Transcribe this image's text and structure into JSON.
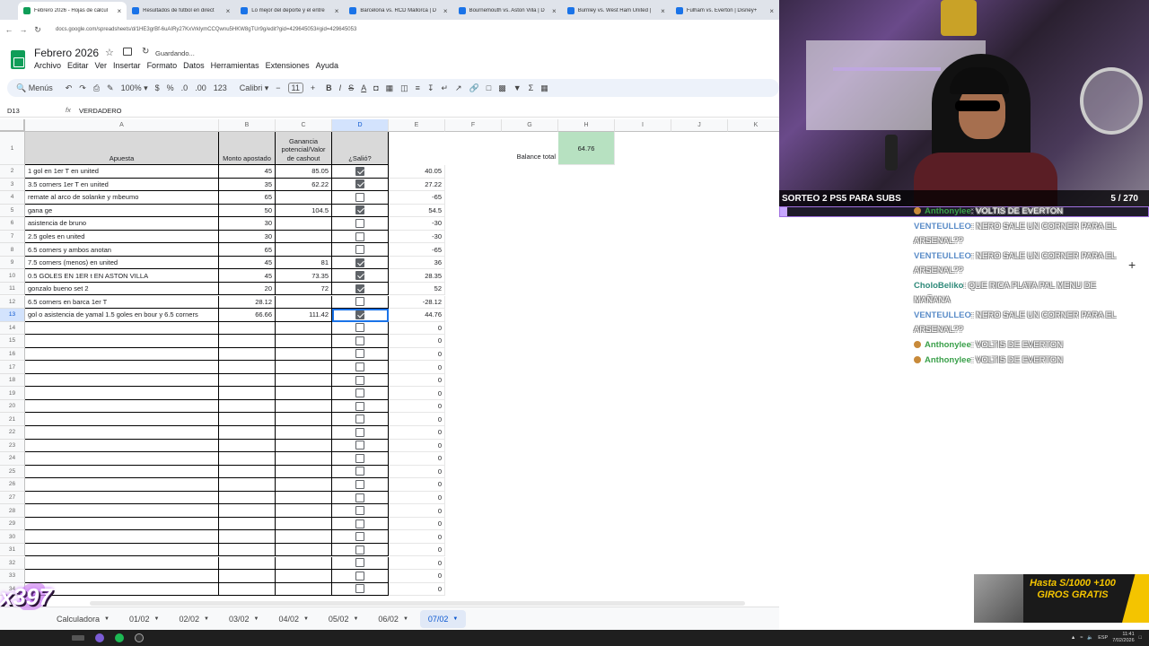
{
  "browser": {
    "tabs": [
      {
        "title": "Febrero 2026 - Hojas de cálcul"
      },
      {
        "title": "Resultados de fútbol en direct"
      },
      {
        "title": "Lo mejor del deporte y el entre"
      },
      {
        "title": "Barcelona vs. RCD Mallorca | D"
      },
      {
        "title": "Bournemouth vs. Aston Villa | D"
      },
      {
        "title": "Burnley vs. West Ham United | "
      },
      {
        "title": "Fulham vs. Everton | Disney+"
      }
    ],
    "url": "docs.google.com/spreadsheets/d/1HE3grBf-6uAIRy27KxVrklymCCQwnu5HKW8gTUr9g/edit?gid=429645053#gid=429645053"
  },
  "doc": {
    "title": "Febrero 2026",
    "status": "Guardando...",
    "menu": [
      "Archivo",
      "Editar",
      "Ver",
      "Insertar",
      "Formato",
      "Datos",
      "Herramientas",
      "Extensiones",
      "Ayuda"
    ]
  },
  "toolbar": {
    "search": "Menús",
    "zoom": "100%",
    "currency": "$",
    "percent": "%",
    "dec_dec": ".0",
    "dec_inc": ".00",
    "format123": "123",
    "font": "Calibri",
    "font_size": "11",
    "bold": "B",
    "italic": "I",
    "strike": "S",
    "textcolor": "A"
  },
  "formula": {
    "ref": "D13",
    "fx": "fx",
    "value": "VERDADERO"
  },
  "sheet": {
    "columns": [
      "A",
      "B",
      "C",
      "D",
      "E",
      "F",
      "G",
      "H",
      "I",
      "J",
      "K"
    ],
    "headers": {
      "apuesta": "Apuesta",
      "monto": "Monto apostado",
      "ganancia": "Ganancia potencial/Valor de cashout",
      "salio": "¿Salió?"
    },
    "balance_label": "Balance total",
    "balance_value": "64.76",
    "rows": [
      {
        "n": "2",
        "a": "1 gol en 1er T en united",
        "b": "45",
        "c": "85.05",
        "d": true,
        "e": "40.05"
      },
      {
        "n": "3",
        "a": "3.5 corners 1er T en united",
        "b": "35",
        "c": "62.22",
        "d": true,
        "e": "27.22"
      },
      {
        "n": "4",
        "a": "remate al arco de solanke y mbeumo",
        "b": "65",
        "c": "",
        "d": false,
        "e": "-65"
      },
      {
        "n": "5",
        "a": "gana ge",
        "b": "50",
        "c": "104.5",
        "d": true,
        "e": "54.5"
      },
      {
        "n": "6",
        "a": "asistencia de bruno",
        "b": "30",
        "c": "",
        "d": false,
        "e": "-30"
      },
      {
        "n": "7",
        "a": "2.5 goles en united",
        "b": "30",
        "c": "",
        "d": false,
        "e": "-30"
      },
      {
        "n": "8",
        "a": "6.5 corners y ambos anotan",
        "b": "65",
        "c": "",
        "d": false,
        "e": "-65"
      },
      {
        "n": "9",
        "a": "7.5 corners (menos) en united",
        "b": "45",
        "c": "81",
        "d": true,
        "e": "36"
      },
      {
        "n": "10",
        "a": "0.5 GOLES EN 1ER t EN ASTON VILLA",
        "b": "45",
        "c": "73.35",
        "d": true,
        "e": "28.35"
      },
      {
        "n": "11",
        "a": "gonzalo bueno set 2",
        "b": "20",
        "c": "72",
        "d": true,
        "e": "52"
      },
      {
        "n": "12",
        "a": "6.5 corners en barca 1er T",
        "b": "28.12",
        "c": "",
        "d": false,
        "e": "-28.12"
      },
      {
        "n": "13",
        "a": "gol o asistencia de yamal 1.5 goles en bour y 6.5 corners",
        "b": "66.66",
        "c": "111.42",
        "d": true,
        "e": "44.76"
      },
      {
        "n": "14",
        "a": "",
        "b": "",
        "c": "",
        "d": false,
        "e": "0"
      },
      {
        "n": "15",
        "a": "",
        "b": "",
        "c": "",
        "d": false,
        "e": "0"
      },
      {
        "n": "16",
        "a": "",
        "b": "",
        "c": "",
        "d": false,
        "e": "0"
      },
      {
        "n": "17",
        "a": "",
        "b": "",
        "c": "",
        "d": false,
        "e": "0"
      },
      {
        "n": "18",
        "a": "",
        "b": "",
        "c": "",
        "d": false,
        "e": "0"
      },
      {
        "n": "19",
        "a": "",
        "b": "",
        "c": "",
        "d": false,
        "e": "0"
      },
      {
        "n": "20",
        "a": "",
        "b": "",
        "c": "",
        "d": false,
        "e": "0"
      },
      {
        "n": "21",
        "a": "",
        "b": "",
        "c": "",
        "d": false,
        "e": "0"
      },
      {
        "n": "22",
        "a": "",
        "b": "",
        "c": "",
        "d": false,
        "e": "0"
      },
      {
        "n": "23",
        "a": "",
        "b": "",
        "c": "",
        "d": false,
        "e": "0"
      },
      {
        "n": "24",
        "a": "",
        "b": "",
        "c": "",
        "d": false,
        "e": "0"
      },
      {
        "n": "25",
        "a": "",
        "b": "",
        "c": "",
        "d": false,
        "e": "0"
      },
      {
        "n": "26",
        "a": "",
        "b": "",
        "c": "",
        "d": false,
        "e": "0"
      },
      {
        "n": "27",
        "a": "",
        "b": "",
        "c": "",
        "d": false,
        "e": "0"
      },
      {
        "n": "28",
        "a": "",
        "b": "",
        "c": "",
        "d": false,
        "e": "0"
      },
      {
        "n": "29",
        "a": "",
        "b": "",
        "c": "",
        "d": false,
        "e": "0"
      },
      {
        "n": "30",
        "a": "",
        "b": "",
        "c": "",
        "d": false,
        "e": "0"
      },
      {
        "n": "31",
        "a": "",
        "b": "",
        "c": "",
        "d": false,
        "e": "0"
      },
      {
        "n": "32",
        "a": "",
        "b": "",
        "c": "",
        "d": false,
        "e": "0"
      },
      {
        "n": "33",
        "a": "",
        "b": "",
        "c": "",
        "d": false,
        "e": "0"
      },
      {
        "n": "34",
        "a": "",
        "b": "",
        "c": "",
        "d": false,
        "e": "0"
      }
    ]
  },
  "sheet_tabs": [
    {
      "label": "Calculadora",
      "active": false
    },
    {
      "label": "01/02",
      "active": false
    },
    {
      "label": "02/02",
      "active": false
    },
    {
      "label": "03/02",
      "active": false
    },
    {
      "label": "04/02",
      "active": false
    },
    {
      "label": "05/02",
      "active": false
    },
    {
      "label": "06/02",
      "active": false
    },
    {
      "label": "07/02",
      "active": true
    }
  ],
  "stream": {
    "banner": "SORTEO 2 PS5 PARA SUBS",
    "counter": "5 / 270",
    "progress": 0.0185,
    "chat": [
      {
        "user": "Anthonylee",
        "text": ": VOLTIS DE EVERTON",
        "badge": true,
        "color": "green"
      },
      {
        "user": "VENTEULLEO",
        "text": ": NERO SALE UN CORNER PARA EL ARSENAL??",
        "badge": false,
        "color": "blue"
      },
      {
        "user": "VENTEULLEO",
        "text": ": NERO SALE UN CORNER PARA EL ARSENAL??",
        "badge": false,
        "color": "blue"
      },
      {
        "user": "CholoBeliko",
        "text": ": QUE RICA PLATA PAL MENU DE MAÑANA",
        "badge": false,
        "color": "teal"
      },
      {
        "user": "VENTEULLEO",
        "text": ": NERO SALE UN CORNER PARA EL ARSENAL??",
        "badge": false,
        "color": "blue"
      },
      {
        "user": "Anthonylee",
        "text": ": VOLTIS DE EVERTON",
        "badge": true,
        "color": "green"
      },
      {
        "user": "Anthonylee",
        "text": ": VOLTIS DE EVERTON",
        "badge": true,
        "color": "green"
      }
    ],
    "promo": "Hasta S/1000 +100 GIROS GRATIS",
    "overlay_tag": "x397"
  },
  "system": {
    "lang": "ESP",
    "time": "11:41",
    "date": "7/02/2026"
  }
}
